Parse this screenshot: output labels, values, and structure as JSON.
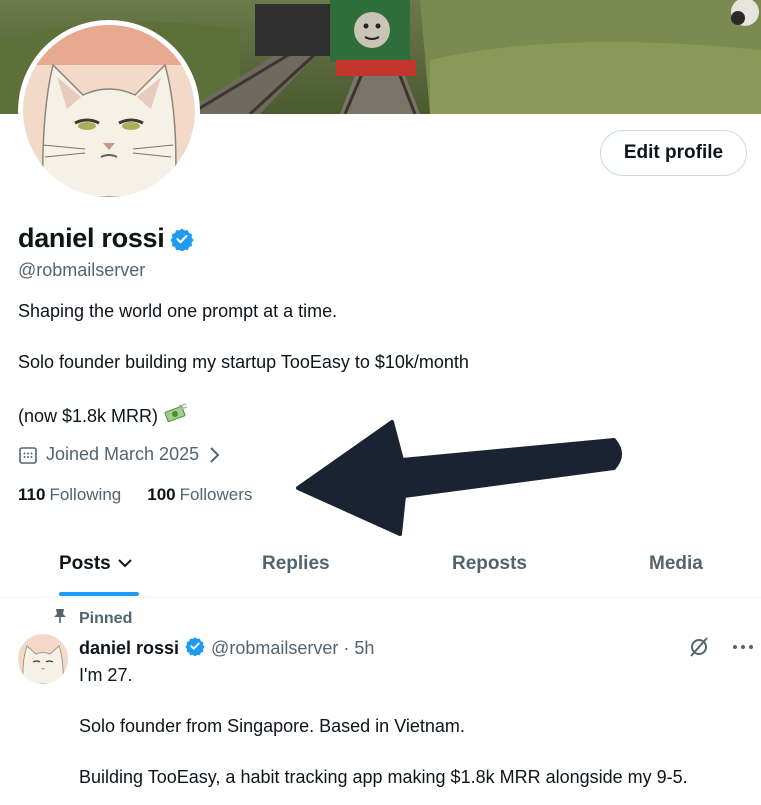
{
  "profile": {
    "name": "daniel rossi",
    "handle": "@robmailserver",
    "bio": [
      "Shaping the world one prompt at a time.",
      "Solo founder building my startup TooEasy to $10k/month",
      "(now $1.8k MRR)"
    ],
    "joined": "Joined March 2025",
    "following_count": "110",
    "following_label": "Following",
    "followers_count": "100",
    "followers_label": "Followers",
    "edit_button": "Edit profile"
  },
  "tabs": [
    {
      "label": "Posts",
      "active": true
    },
    {
      "label": "Replies",
      "active": false
    },
    {
      "label": "Reposts",
      "active": false
    },
    {
      "label": "Media",
      "active": false
    }
  ],
  "post": {
    "pinned_label": "Pinned",
    "author": "daniel rossi",
    "meta": "@robmailserver · 5h",
    "lines": [
      "I'm 27.",
      "Solo founder from Singapore. Based in Vietnam.",
      "Building TooEasy, a habit tracking app making $1.8k MRR alongside my 9-5."
    ]
  },
  "colors": {
    "accent": "#1d9bf0",
    "verified": "#1d9bf0",
    "arrow": "#1a2332",
    "secondary_text": "#536471"
  },
  "icons": [
    "verified-badge-icon",
    "calendar-icon",
    "chevron-right-icon",
    "chevron-down-icon",
    "pin-icon",
    "grok-icon",
    "more-icon",
    "money-emoji-icon"
  ]
}
